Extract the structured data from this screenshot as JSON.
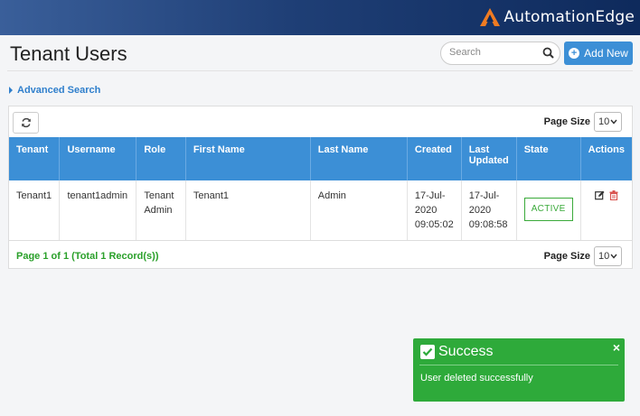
{
  "brand": {
    "name": "AutomationEdge",
    "logo_icon": "automationedge-logo-icon",
    "accent": "#f07b22"
  },
  "page": {
    "title": "Tenant Users"
  },
  "search": {
    "placeholder": "Search",
    "icon": "search-icon"
  },
  "toolbar": {
    "add_new_label": "Add New",
    "refresh_icon": "refresh-icon"
  },
  "advanced_search": {
    "label": "Advanced Search"
  },
  "page_size": {
    "label": "Page Size",
    "value": "10"
  },
  "table": {
    "columns": [
      "Tenant",
      "Username",
      "Role",
      "First Name",
      "Last Name",
      "Created",
      "Last Updated",
      "State",
      "Actions"
    ],
    "rows": [
      {
        "tenant": "Tenant1",
        "username": "tenant1admin",
        "role": "Tenant Admin",
        "first_name": "Tenant1",
        "last_name": "Admin",
        "created_date": "17-Jul-2020",
        "created_time": "09:05:02",
        "updated_date": "17-Jul-2020",
        "updated_time": "09:08:58",
        "state": "ACTIVE"
      }
    ]
  },
  "pagination": {
    "summary": "Page 1 of 1 (Total 1 Record(s))"
  },
  "toast": {
    "title": "Success",
    "message": "User deleted successfully",
    "close_glyph": "×",
    "color": "#2eaa3a"
  },
  "colors": {
    "header_bg": "#1f3f76",
    "table_header": "#3c8fd6",
    "status_green": "#3aaa3a",
    "delete_red": "#d9534f"
  }
}
